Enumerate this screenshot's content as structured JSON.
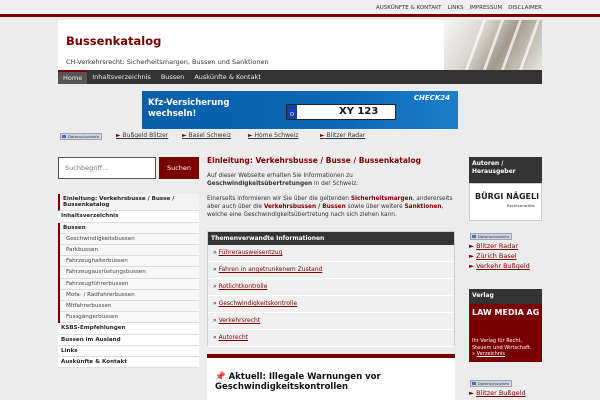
{
  "top_links": [
    "AUSKÜNFTE & KONTAKT",
    "LINKS",
    "IMPRESSUM",
    "DISCLAIMER"
  ],
  "site": {
    "title": "Bussenkatalog",
    "tagline": "CH-Verkehrsrecht: Sicherheitsmargen, Bussen und Sanktionen"
  },
  "nav": [
    "Home",
    "Inhaltsverzeichnis",
    "Bussen",
    "Auskünfte & Kontakt"
  ],
  "ad": {
    "headline": "Kfz-Versicherung wechseln!",
    "plate_country": "D",
    "plate": "XY 123",
    "brand": "CHECK24"
  },
  "ad_badge": "Datenschutzinfo",
  "ad_links": [
    "Bußgeld Blitzer",
    "Basel Schweiz",
    "Home Schweiz",
    "Blitzer Radar"
  ],
  "search": {
    "placeholder": "Suchbegriff...",
    "button": "Suchen"
  },
  "left_nav": {
    "top": [
      "Einleitung: Verkehrsbusse / Busse / Bussenkatalog",
      "Inhaltsverzeichnis",
      "Bussen"
    ],
    "sub": [
      "Geschwindigkeitsbussen",
      "Parkbussen",
      "Fahrzeughalterbussen",
      "Fahrzeugausrüstungsbussen",
      "Fahrzeugführerbussen",
      "Mofa- / Radfahrerbussen",
      "Mitfahrerbussen",
      "Fussgängerbussen"
    ],
    "bottom": [
      "KSBS-Empfehlungen",
      "Bussen im Ausland",
      "Links",
      "Auskünfte & Kontakt"
    ]
  },
  "main": {
    "heading": "Einleitung: Verkehrsbusse / Busse / Bussenkatalog",
    "p1_a": "Auf dieser Webseite erhalten Sie Informationen zu",
    "p1_b": "Geschwindigkeitsübertretungen",
    "p1_c": " in der Schweiz:",
    "p2_a": "Einerseits informieren wir Sie über die geltenden ",
    "p2_link1": "Sicherheitsmargen",
    "p2_b": ", andererseits aber auch über die ",
    "p2_link2": "Verkehrsbussen / Bussen",
    "p2_c": " sowie über weitere ",
    "p2_link3": "Sanktionen",
    "p2_d": ", welche eine Geschwindigkeitsübertretung nach sich ziehen kann.",
    "related_title": "Themenverwandte Informationen",
    "related": [
      "Führerausweisentzug",
      "Fahren in angetrunkenem Zustand",
      "Rotlichtkontrolle",
      "Geschwindigkeitskontrolle",
      "Verkehrsrecht",
      "Autorecht"
    ],
    "news_title": "Aktuell: Illegale Warnungen vor Geschwindigkeitskontrollen"
  },
  "right": {
    "authors_title": "Autoren / Herausgeber",
    "logo_name": "BÜRGI NÄGELI",
    "logo_sub": "Rechtsanwälte",
    "ad_links": [
      "Blitzer Radar",
      "Zürich Basel",
      "Verkehr Bußgeld"
    ],
    "publisher_title": "Verlag",
    "lawmedia_name": "LAW MEDIA AG",
    "lawmedia_text": "Ihr Verlag für Recht, Steuern und Wirtschaft.",
    "lawmedia_link": "Verzeichnis",
    "ad_links2": [
      "Blitzer Bußgeld"
    ]
  },
  "colors": {
    "accent": "#7a0000",
    "nav_bg": "#333333",
    "ad_blue": "#0a66b6"
  }
}
